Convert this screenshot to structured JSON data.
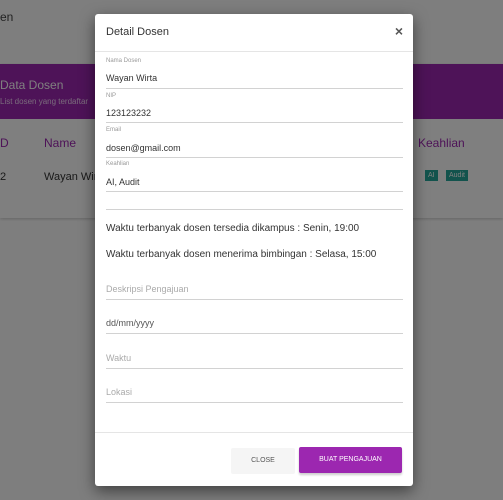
{
  "background": {
    "title_fragment": "en",
    "card": {
      "title": "Data Dosen",
      "subtitle": "List dosen yang terdaftar"
    },
    "table": {
      "headers": [
        "D",
        "Name",
        "Keahlian"
      ],
      "row": {
        "id": "2",
        "name": "Wayan Wirt",
        "tags": [
          "AI",
          "Audit"
        ]
      }
    },
    "colors": {
      "accent": "#9c27b0",
      "tag": "#26a69a"
    }
  },
  "modal": {
    "title": "Detail Dosen",
    "close_icon": "close-icon",
    "fields": [
      {
        "label": "Nama Dosen",
        "value": "Wayan Wirta"
      },
      {
        "label": "NIP",
        "value": "123123232"
      },
      {
        "label": "Email",
        "value": "dosen@gmail.com"
      },
      {
        "label": "Keahlian",
        "value": "AI, Audit"
      }
    ],
    "info": {
      "available": "Waktu terbanyak dosen tersedia dikampus : Senin, 19:00",
      "guidance": "Waktu terbanyak dosen menerima bimbingan : Selasa, 15:00"
    },
    "form": {
      "description_placeholder": "Deskripsi Pengajuan",
      "date_value": "dd/mm/yyyy",
      "time_placeholder": "Waktu",
      "location_placeholder": "Lokasi"
    },
    "buttons": {
      "close": "CLOSE",
      "submit": "BUAT PENGAJUAN"
    }
  }
}
